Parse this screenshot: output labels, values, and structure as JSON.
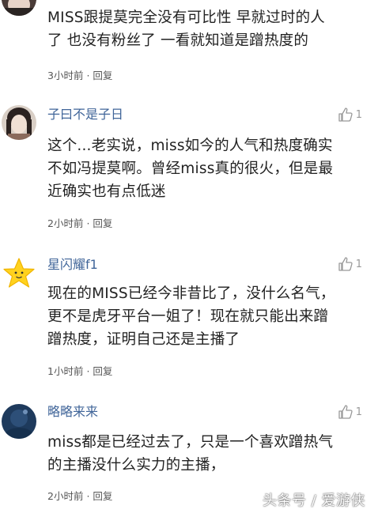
{
  "comments": [
    {
      "username": "",
      "text_lines": [
        "MISS跟提莫完全没有可比性  早就过时的人",
        "了 也没有粉丝了   一看就知道是蹭热度的"
      ],
      "time": "3小时前",
      "dot": "·",
      "reply": "回复",
      "likes": ""
    },
    {
      "username": "子曰不是子日",
      "text_lines": [
        "这个...老实说，miss如今的人气和热度确实",
        "不如冯提莫啊。曾经miss真的很火，但是最",
        "近确实也有点低迷"
      ],
      "time": "2小时前",
      "dot": "·",
      "reply": "回复",
      "likes": "1"
    },
    {
      "username": "星闪耀f1",
      "text_lines": [
        "现在的MISS已经今非昔比了，没什么名气，",
        "更不是虎牙平台一姐了！现在就只能出来蹭",
        "蹭热度，证明自己还是主播了"
      ],
      "time": "1小时前",
      "dot": "·",
      "reply": "回复",
      "likes": "1"
    },
    {
      "username": "略略来来",
      "text_lines": [
        "miss都是已经过去了，只是一个喜欢蹭热气",
        "的主播没什么实力的主播，"
      ],
      "time": "2小时前",
      "dot": "·",
      "reply": "回复",
      "likes": "1"
    }
  ],
  "watermark": "头条号 / 爱游侠",
  "colors": {
    "username": "#406599",
    "text": "#222222",
    "meta": "#555555",
    "like": "#999999"
  },
  "icons": {
    "like": "thumbs-up-icon",
    "star_avatar": "star-icon"
  }
}
